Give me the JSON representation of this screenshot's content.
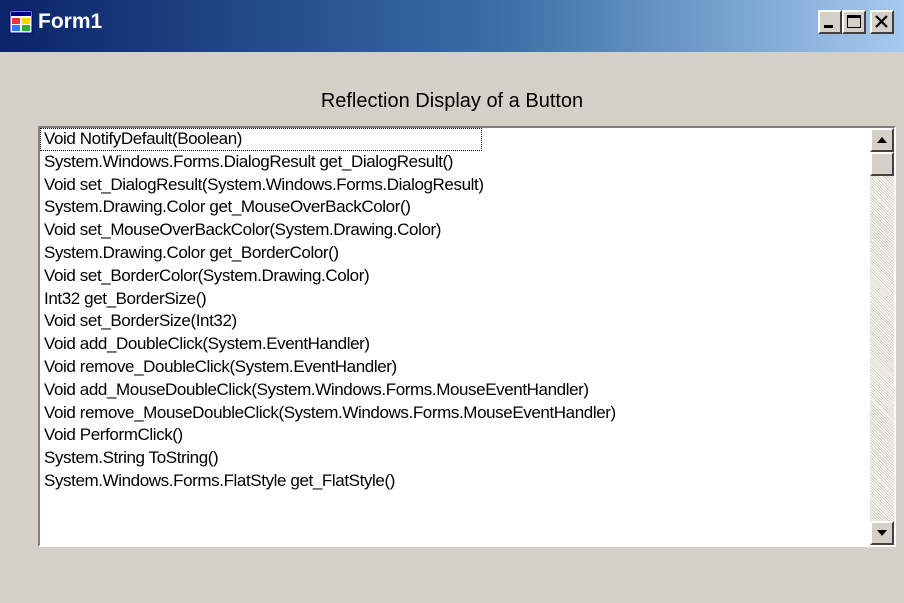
{
  "window": {
    "title": "Form1",
    "icon": "form-icon",
    "controls": [
      "minimize-icon",
      "maximize-icon",
      "close-icon"
    ]
  },
  "heading": "Reflection Display of a Button",
  "listbox": {
    "items": [
      "Void NotifyDefault(Boolean)",
      "System.Windows.Forms.DialogResult get_DialogResult()",
      "Void set_DialogResult(System.Windows.Forms.DialogResult)",
      "System.Drawing.Color get_MouseOverBackColor()",
      "Void set_MouseOverBackColor(System.Drawing.Color)",
      "System.Drawing.Color get_BorderColor()",
      "Void set_BorderColor(System.Drawing.Color)",
      "Int32 get_BorderSize()",
      "Void set_BorderSize(Int32)",
      "Void add_DoubleClick(System.EventHandler)",
      "Void remove_DoubleClick(System.EventHandler)",
      "Void add_MouseDoubleClick(System.Windows.Forms.MouseEventHandler)",
      "Void remove_MouseDoubleClick(System.Windows.Forms.MouseEventHandler)",
      "Void PerformClick()",
      "System.String ToString()",
      "System.Windows.Forms.FlatStyle get_FlatStyle()"
    ],
    "scroll_position": 0
  },
  "colors": {
    "titlebar_start": "#0a246a",
    "titlebar_end": "#a6caf0",
    "face": "#d4d0c8"
  }
}
